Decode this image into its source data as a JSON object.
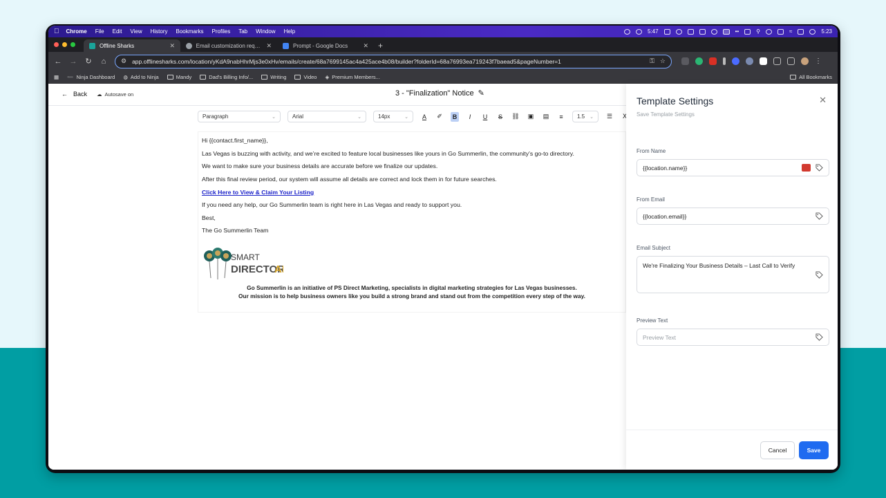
{
  "menubar": {
    "app": "Chrome",
    "items": [
      "File",
      "Edit",
      "View",
      "History",
      "Bookmarks",
      "Profiles",
      "Tab",
      "Window",
      "Help"
    ],
    "timer": "5:47",
    "clock": "5:23"
  },
  "tabs": [
    {
      "label": "Offline Sharks",
      "active": true,
      "color": "#1aa39a"
    },
    {
      "label": "Email customization request",
      "active": false,
      "color": "#9aa0a6"
    },
    {
      "label": "Prompt - Google Docs",
      "active": false,
      "color": "#4285f4"
    }
  ],
  "address": {
    "url": "app.offlinesharks.com/location/yKdA9nabHhrMjs3e0xHv/emails/create/68a7699145ac4a425ace4b08/builder?folderId=68a76993ea719243f7baead5&pageNumber=1"
  },
  "bookmarks": {
    "items": [
      "Ninja Dashboard",
      "Add to Ninja",
      "Mandy",
      "Dad's Billing Info/...",
      "Writing",
      "Video",
      "Premium Members..."
    ],
    "all": "All Bookmarks"
  },
  "editor": {
    "back_label": "Back",
    "autosave_label": "Autosave on",
    "title": "3 - \"Finalization\" Notice",
    "format": {
      "block": "Paragraph",
      "font": "Arial",
      "size": "14px",
      "line_height": "1.5"
    },
    "body": {
      "greeting": "Hi {{contact.first_name}},",
      "line1": "Las Vegas is buzzing with activity, and we’re excited to feature local businesses like yours in Go Summerlin, the community’s go-to directory.",
      "line2": "We want to make sure your business details are accurate before we finalize our updates.",
      "line3": "After this final review period, our system will assume all details are correct and lock them in for future searches.",
      "link": "Click Here to View & Claim Your Listing",
      "line4": "If you need any help, our Go Summerlin team is right here in Las Vegas and ready to support you.",
      "signoff": "Best,",
      "signature": "The Go Summerlin Team",
      "logo_text_1": "SMART",
      "logo_text_2": "DIRECTORY",
      "logo_text_3": "AI",
      "footer1": "Go Summerlin is an initiative of PS Direct Marketing, specialists in digital marketing strategies for Las Vegas businesses.",
      "footer2": "Our mission is to help business owners like you build a strong brand and stand out from the competition every step of the way."
    }
  },
  "panel": {
    "title": "Template Settings",
    "subtitle": "Save Template Settings",
    "from_name_label": "From Name",
    "from_name_value": "{{location.name}}",
    "from_email_label": "From Email",
    "from_email_value": "{{location.email}}",
    "subject_label": "Email Subject",
    "subject_value": "We're Finalizing Your Business Details – Last Call to Verify",
    "preview_label": "Preview Text",
    "preview_placeholder": "Preview Text",
    "cancel_label": "Cancel",
    "save_label": "Save"
  },
  "colors": {
    "accent": "#1f6bf0",
    "link": "#1d24c9",
    "background_top": "#e6f7fb",
    "background_band": "#019ea3"
  }
}
